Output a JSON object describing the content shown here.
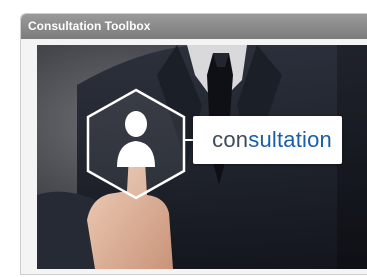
{
  "panel": {
    "title": "Consultation Toolbox"
  },
  "banner": {
    "label_part_a": "con",
    "label_part_b": "sultation",
    "icon": "consultant-person-icon"
  },
  "colors": {
    "header_bg": "#8a8a8a",
    "accent_blue": "#1a5ea8",
    "suit_dark": "#1e2330"
  }
}
